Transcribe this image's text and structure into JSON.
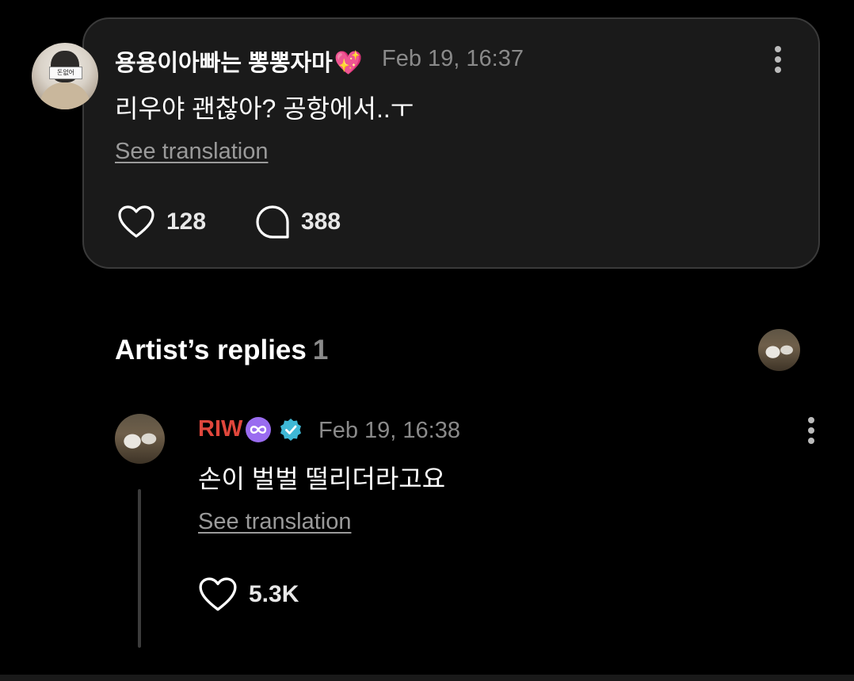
{
  "post": {
    "author": "용용이아빠는 뽕뽕자마",
    "author_emoji": "💖",
    "avatar_sign_text": "돈없어",
    "timestamp": "Feb 19, 16:37",
    "text": "리우야 괜찮아? 공항에서..ㅜ",
    "see_translation": "See translation",
    "like_count": "128",
    "reply_count": "388"
  },
  "artist_replies": {
    "title": "Artist’s replies",
    "count": "1"
  },
  "reply": {
    "author": "RIW",
    "timestamp": "Feb 19, 16:38",
    "text": "손이 벌벌 떨리더라고요",
    "see_translation": "See translation",
    "like_count": "5.3K"
  },
  "colors": {
    "background": "#000000",
    "card": "#1a1a1a",
    "artist_name": "#e0473c",
    "muted": "#8a8a8a",
    "verified": "#3fb8d6",
    "infinity_badge": "#9a6cf0"
  },
  "icons": {
    "like": "heart-outline-icon",
    "reply": "speech-bubble-icon",
    "more": "kebab-menu-icon",
    "verified": "verified-badge-icon",
    "membership": "infinity-badge-icon"
  }
}
